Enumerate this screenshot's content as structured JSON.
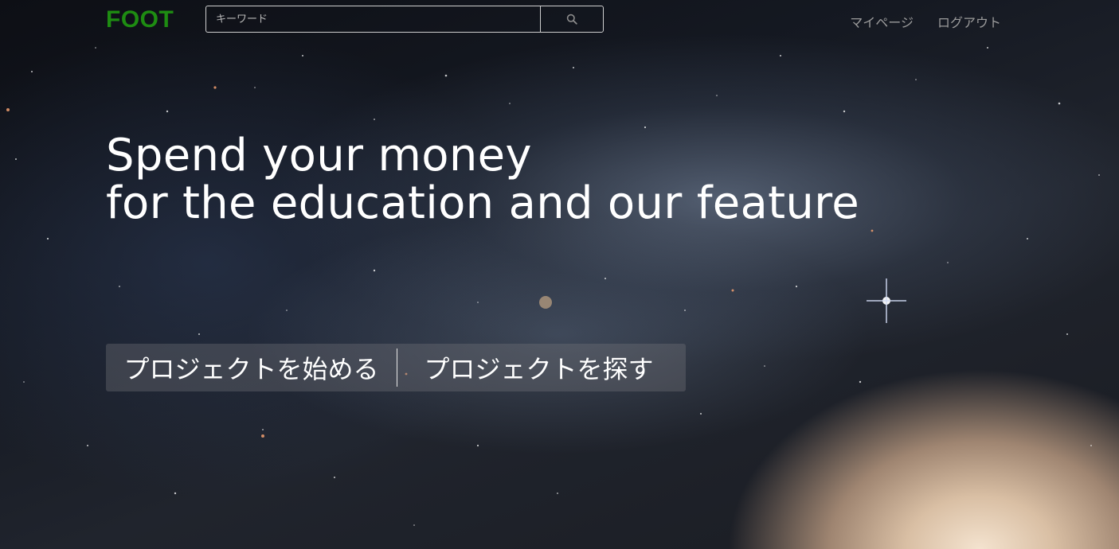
{
  "header": {
    "brand": "FOOT",
    "search": {
      "placeholder": "キーワード",
      "value": "",
      "button_icon": "search-icon"
    },
    "nav": [
      {
        "label": "マイページ"
      },
      {
        "label": "ログアウト"
      }
    ]
  },
  "hero": {
    "title_line1": "Spend your money",
    "title_line2": "for the education and our feature"
  },
  "cta": {
    "start_label": "プロジェクトを始める",
    "find_label": "プロジェクトを探す"
  },
  "colors": {
    "brand": "#1e8c12",
    "nav_text": "#9b9b9b",
    "hero_text": "#ffffff"
  }
}
